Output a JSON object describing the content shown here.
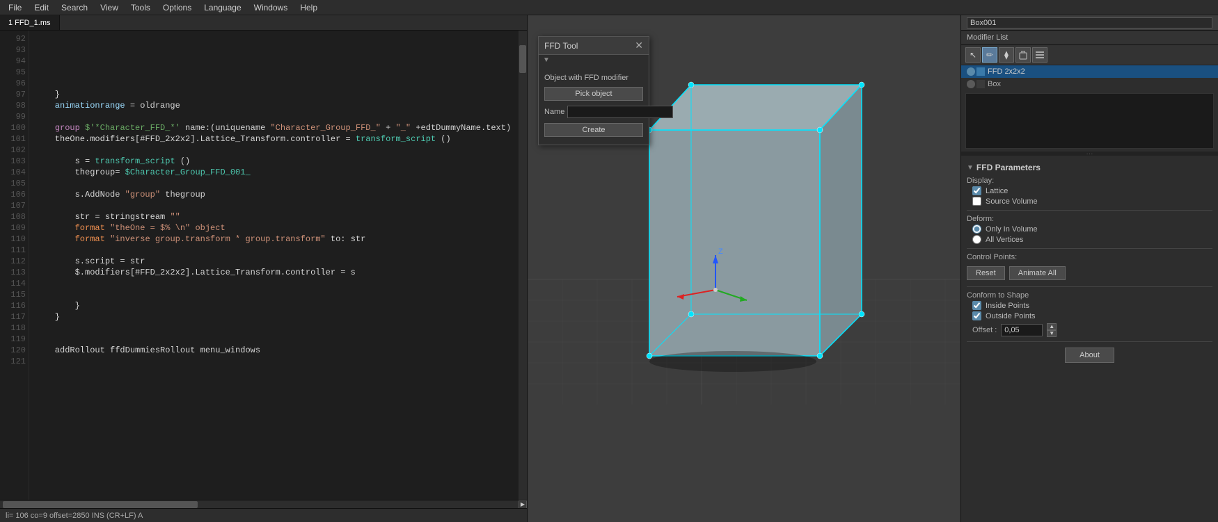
{
  "menubar": {
    "items": [
      "File",
      "Edit",
      "Search",
      "View",
      "Tools",
      "Options",
      "Language",
      "Windows",
      "Help"
    ]
  },
  "editor": {
    "tab_label": "1 FFD_1.ms",
    "status": "li= 106  co=9  offset=2850  INS  (CR+LF)  A",
    "lines": [
      {
        "num": "92",
        "tokens": []
      },
      {
        "num": "93",
        "tokens": []
      },
      {
        "num": "94",
        "tokens": []
      },
      {
        "num": "95",
        "tokens": []
      },
      {
        "num": "96",
        "tokens": [
          {
            "t": "    }",
            "c": "white"
          }
        ]
      },
      {
        "num": "97",
        "tokens": [
          {
            "t": "    animationrange",
            "c": "light-blue"
          },
          {
            "t": " = oldrange",
            "c": "white"
          }
        ]
      },
      {
        "num": "98",
        "tokens": []
      },
      {
        "num": "99",
        "tokens": [
          {
            "t": "    group",
            "c": "white"
          },
          {
            "t": " $'*Character_FFD_*'",
            "c": "green"
          },
          {
            "t": " name:",
            "c": "white"
          },
          {
            "t": "(uniquename",
            "c": "white"
          },
          {
            "t": " \"Character_Group_FFD_\"",
            "c": "string"
          },
          {
            "t": " + ",
            "c": "white"
          },
          {
            "t": "\"_\"",
            "c": "string"
          },
          {
            "t": " +edtDummyName.text)",
            "c": "white"
          }
        ]
      },
      {
        "num": "100",
        "tokens": [
          {
            "t": "    theOne.modifiers[#FFD_2x2x2].Lattice_Transform.controller = ",
            "c": "white"
          },
          {
            "t": "transform_script",
            "c": "cyan"
          },
          {
            "t": " ()",
            "c": "white"
          }
        ]
      },
      {
        "num": "101",
        "tokens": []
      },
      {
        "num": "102",
        "tokens": [
          {
            "t": "        s = ",
            "c": "white"
          },
          {
            "t": "transform_script",
            "c": "cyan"
          },
          {
            "t": " ()",
            "c": "white"
          }
        ]
      },
      {
        "num": "103",
        "tokens": [
          {
            "t": "        thegroup= ",
            "c": "white"
          },
          {
            "t": "$Character_Group_FFD_001_",
            "c": "cyan"
          }
        ]
      },
      {
        "num": "104",
        "tokens": []
      },
      {
        "num": "105",
        "tokens": [
          {
            "t": "        s.AddNode ",
            "c": "white"
          },
          {
            "t": "\"group\"",
            "c": "string"
          },
          {
            "t": " thegroup",
            "c": "white"
          }
        ]
      },
      {
        "num": "106",
        "tokens": []
      },
      {
        "num": "107",
        "tokens": [
          {
            "t": "        str = stringstream ",
            "c": "white"
          },
          {
            "t": "\"\"",
            "c": "string"
          }
        ]
      },
      {
        "num": "108",
        "tokens": [
          {
            "t": "        format ",
            "c": "orange"
          },
          {
            "t": "\"theOne = $% \\n\" object",
            "c": "string"
          }
        ]
      },
      {
        "num": "109",
        "tokens": [
          {
            "t": "        format ",
            "c": "orange"
          },
          {
            "t": "\"inverse group.transform * group.transform\"",
            "c": "string"
          },
          {
            "t": " to: str",
            "c": "white"
          }
        ]
      },
      {
        "num": "110",
        "tokens": []
      },
      {
        "num": "111",
        "tokens": [
          {
            "t": "        s.script = str",
            "c": "white"
          }
        ]
      },
      {
        "num": "112",
        "tokens": [
          {
            "t": "        $.modifiers[#FFD_2x2x2].Lattice_Transform.controller = s",
            "c": "white"
          }
        ]
      },
      {
        "num": "113",
        "tokens": []
      },
      {
        "num": "114",
        "tokens": []
      },
      {
        "num": "115",
        "tokens": [
          {
            "t": "        }",
            "c": "white"
          }
        ]
      },
      {
        "num": "116",
        "tokens": [
          {
            "t": "    }",
            "c": "white"
          }
        ]
      },
      {
        "num": "117",
        "tokens": []
      },
      {
        "num": "118",
        "tokens": []
      },
      {
        "num": "119",
        "tokens": [
          {
            "t": "    addRollout",
            "c": "white"
          },
          {
            "t": " ffdDummiesRollout menu_windows",
            "c": "white"
          }
        ]
      },
      {
        "num": "120",
        "tokens": []
      },
      {
        "num": "121",
        "tokens": []
      }
    ]
  },
  "ffd_dialog": {
    "title": "FFD Tool",
    "section_label": "Object with FFD modifier",
    "pick_btn": "Pick object",
    "name_label": "Name",
    "create_btn": "Create"
  },
  "object_name": "Box001",
  "modifier_list_label": "Modifier List",
  "modifier_stack": [
    {
      "name": "FFD 2x2x2",
      "selected": true
    },
    {
      "name": "Box",
      "selected": false
    }
  ],
  "ffd_params": {
    "section_title": "FFD Parameters",
    "display_label": "Display:",
    "lattice_label": "Lattice",
    "source_volume_label": "Source Volume",
    "deform_label": "Deform:",
    "only_in_volume_label": "Only In Volume",
    "all_vertices_label": "All Vertices",
    "control_points_label": "Control Points:",
    "reset_btn": "Reset",
    "animate_all_btn": "Animate All",
    "conform_label": "Conform to Shape",
    "inside_points_label": "Inside Points",
    "outside_points_label": "Outside Points",
    "offset_label": "Offset :",
    "offset_value": "0,05",
    "about_btn": "About"
  },
  "toolbar_icons": {
    "cursor": "↖",
    "edit": "✏",
    "hierarchy": "⧫",
    "delete": "🗑",
    "properties": "☰"
  }
}
